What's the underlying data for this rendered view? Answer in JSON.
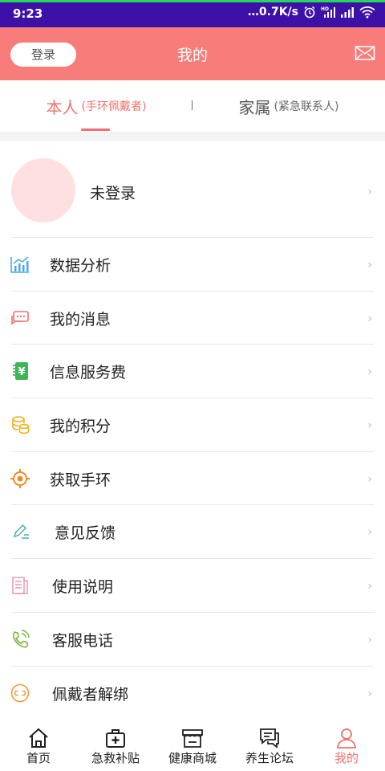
{
  "status_bar": {
    "time": "9:23",
    "net_speed": "…0.7K/s",
    "icons": [
      "alarm-icon",
      "hd-signal-icon",
      "signal-icon",
      "wifi-icon"
    ]
  },
  "header": {
    "login_label": "登录",
    "title": "我的",
    "right_icon": "mail-icon",
    "bg_color": "#f77c7a"
  },
  "tabs": [
    {
      "label": "本人",
      "sublabel": "(手环佩戴者)",
      "active": true
    },
    {
      "label": "家属",
      "sublabel": "(紧急联系人)",
      "active": false
    }
  ],
  "profile": {
    "name": "未登录"
  },
  "menu": [
    {
      "label": "数据分析",
      "icon": "chart-icon"
    },
    {
      "label": "我的消息",
      "icon": "message-icon"
    },
    {
      "label": "信息服务费",
      "icon": "yuan-icon"
    },
    {
      "label": "我的积分",
      "icon": "coins-icon"
    },
    {
      "label": "获取手环",
      "icon": "target-icon"
    },
    {
      "label": "意见反馈",
      "icon": "feedback-icon"
    },
    {
      "label": "使用说明",
      "icon": "document-icon"
    },
    {
      "label": "客服电话",
      "icon": "phone-icon"
    },
    {
      "label": "佩戴者解绑",
      "icon": "unbind-icon"
    }
  ],
  "chevron": "›",
  "bottom_nav": [
    {
      "label": "首页",
      "icon": "home-icon",
      "active": false
    },
    {
      "label": "急救补贴",
      "icon": "first-aid-icon",
      "active": false
    },
    {
      "label": "健康商城",
      "icon": "store-icon",
      "active": false
    },
    {
      "label": "养生论坛",
      "icon": "forum-icon",
      "active": false
    },
    {
      "label": "我的",
      "icon": "user-icon",
      "active": true
    }
  ],
  "colors": {
    "accent": "#f0706d",
    "status_bar": "#3d10a8"
  }
}
